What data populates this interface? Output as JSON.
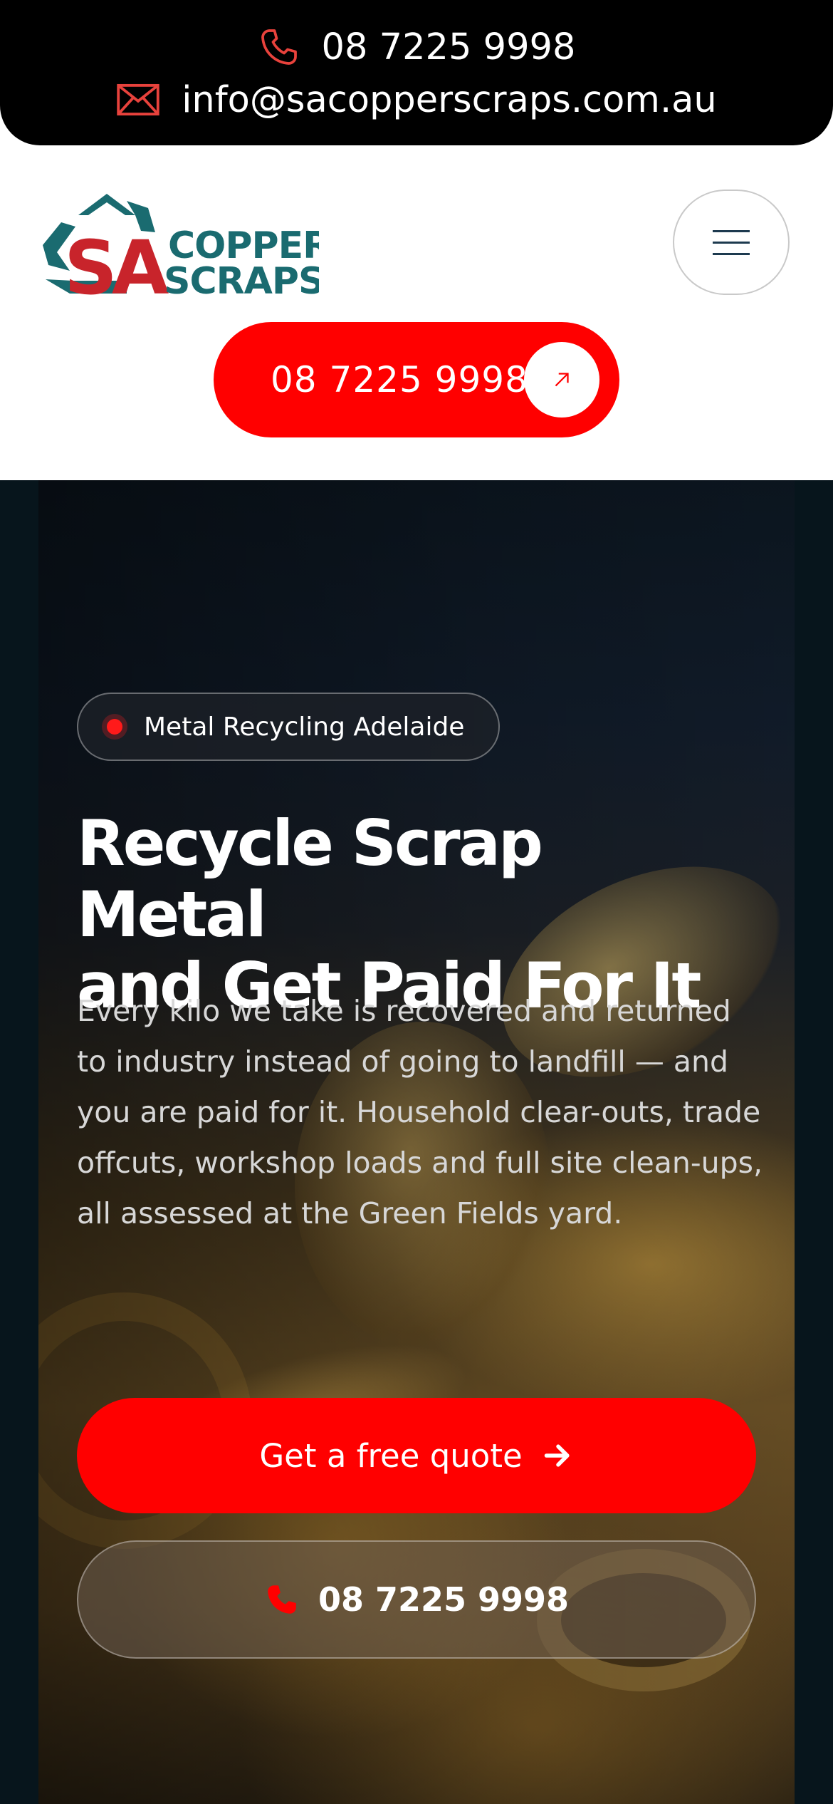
{
  "topbar": {
    "phone": "08 7225 9998",
    "email": "info@sacopperscraps.com.au",
    "phone_icon": "phone-outline-icon",
    "email_icon": "envelope-icon",
    "icon_color": "#e8423c"
  },
  "header": {
    "logo": {
      "mark": "SA",
      "line1": "COPPER",
      "line2": "SCRAPS"
    },
    "menu_icon": "hamburger-menu-icon",
    "call_button": {
      "label": "08 7225 9998",
      "icon": "arrow-up-right-icon"
    }
  },
  "hero": {
    "badge": "Metal Recycling Adelaide",
    "title_line1": "Recycle Scrap Metal",
    "title_line2": "and Get Paid For It",
    "body": "Every kilo we take is recovered and returned to industry instead of going to landfill — and you are paid for it. Household clear-outs, trade offcuts, workshop loads and full site clean-ups, all assessed at the Green Fields yard.",
    "primary_cta": {
      "label": "Get a free quote",
      "icon": "arrow-right-icon"
    },
    "secondary_cta": {
      "label": "08 7225 9998",
      "icon": "phone-icon"
    }
  },
  "colors": {
    "brand_red": "#ff0000",
    "brand_teal": "#1a6b70",
    "logo_red": "#c8242b",
    "topbar_bg": "#000000"
  }
}
